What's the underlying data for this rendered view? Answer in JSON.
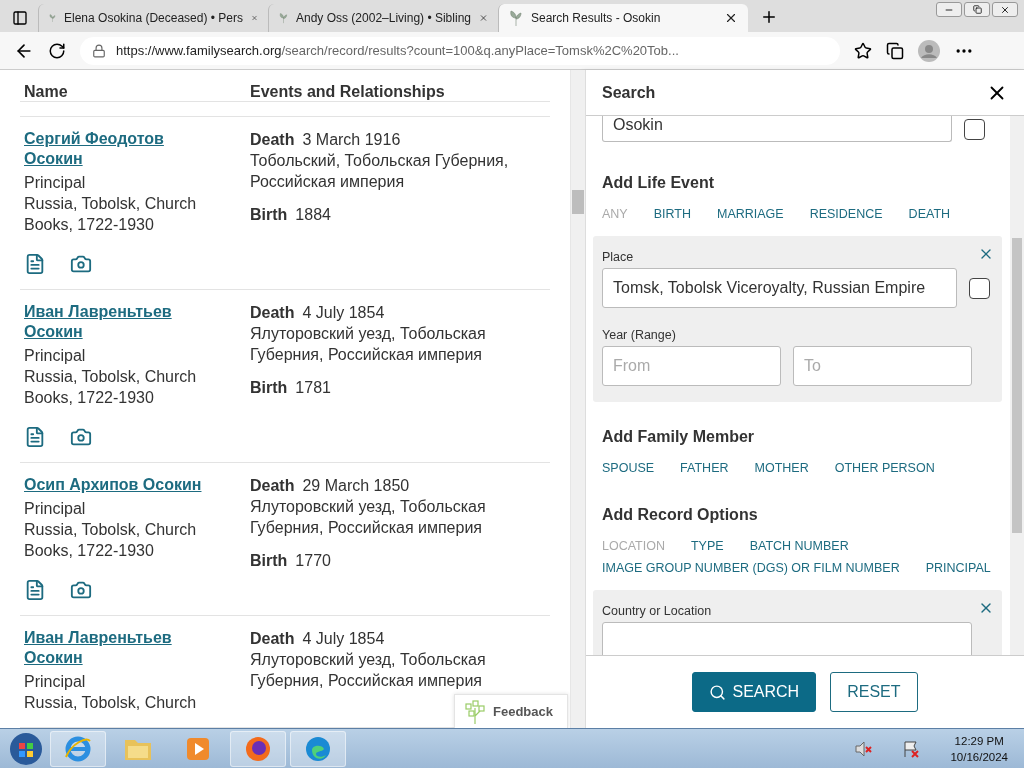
{
  "browser": {
    "tabs": [
      {
        "title": "Elena Osokina (Deceased) • Pers",
        "selected": false
      },
      {
        "title": "Andy Oss (2002–Living) • Sibling",
        "selected": false
      },
      {
        "title": "Search Results - Osokin",
        "selected": true
      }
    ],
    "url_host": "https://www.familysearch.org",
    "url_path": "/search/record/results?count=100&q.anyPlace=Tomsk%2C%20Tob..."
  },
  "results": {
    "columns": [
      "Name",
      "Events and Relationships"
    ],
    "rows": [
      {
        "name": "Сергий Феодотов Осокин",
        "role": "Principal",
        "collection": "Russia, Tobolsk, Church Books, 1722-1930",
        "events": [
          {
            "type": "Death",
            "date": "3 March 1916",
            "place": "Тобольский, Тобольская Губерния, Российская империя"
          },
          {
            "type": "Birth",
            "date": "1884"
          }
        ],
        "record_links": true
      },
      {
        "name": "Иван Лавреньтьев Осокин",
        "role": "Principal",
        "collection": "Russia, Tobolsk, Church Books, 1722-1930",
        "events": [
          {
            "type": "Death",
            "date": "4 July 1854",
            "place": "Ялуторовский уезд, Тобольская Губерния, Российская империя"
          },
          {
            "type": "Birth",
            "date": "1781"
          }
        ],
        "record_links": true
      },
      {
        "name": "Осип Архипов Осокин",
        "role": "Principal",
        "collection": "Russia, Tobolsk, Church Books, 1722-1930",
        "events": [
          {
            "type": "Death",
            "date": "29 March 1850",
            "place": "Ялуторовский уезд, Тобольская Губерния, Российская империя"
          },
          {
            "type": "Birth",
            "date": "1770"
          }
        ],
        "record_links": true
      },
      {
        "name": "Иван Лавреньтьев Осокин",
        "role": "Principal",
        "collection": "Russia, Tobolsk, Church",
        "events": [
          {
            "type": "Death",
            "date": "4 July 1854",
            "place": "Ялуторовский уезд, Тобольская Губерния, Российская империя"
          }
        ],
        "record_links": false
      }
    ],
    "feedback": "Feedback"
  },
  "search_panel": {
    "title": "Search",
    "surname": {
      "value": "Osokin",
      "checked": false
    },
    "life_event": {
      "heading": "Add Life Event",
      "options": [
        {
          "label": "ANY",
          "disabled": true
        },
        {
          "label": "BIRTH",
          "disabled": false
        },
        {
          "label": "MARRIAGE",
          "disabled": false
        },
        {
          "label": "RESIDENCE",
          "disabled": false
        },
        {
          "label": "DEATH",
          "disabled": false
        }
      ],
      "place_label": "Place",
      "place_value": "Tomsk, Tobolsk Viceroyalty, Russian Empire",
      "place_checked": false,
      "year_label": "Year (Range)",
      "from_placeholder": "From",
      "to_placeholder": "To"
    },
    "family": {
      "heading": "Add Family Member",
      "options": [
        {
          "label": "SPOUSE",
          "disabled": false
        },
        {
          "label": "FATHER",
          "disabled": false
        },
        {
          "label": "MOTHER",
          "disabled": false
        },
        {
          "label": "OTHER PERSON",
          "disabled": false
        }
      ]
    },
    "record": {
      "heading": "Add Record Options",
      "options": [
        {
          "label": "LOCATION",
          "disabled": true
        },
        {
          "label": "TYPE",
          "disabled": false
        },
        {
          "label": "BATCH NUMBER",
          "disabled": false
        },
        {
          "label": "IMAGE GROUP NUMBER (DGS) OR FILM NUMBER",
          "disabled": false
        },
        {
          "label": "PRINCIPAL",
          "disabled": false
        }
      ],
      "location_label": "Country or Location"
    },
    "buttons": [
      {
        "kind": "primary",
        "label": "SEARCH"
      },
      {
        "kind": "secondary",
        "label": "RESET"
      }
    ]
  },
  "taskbar": {
    "time": "12:29 PM",
    "date": "10/16/2024"
  }
}
